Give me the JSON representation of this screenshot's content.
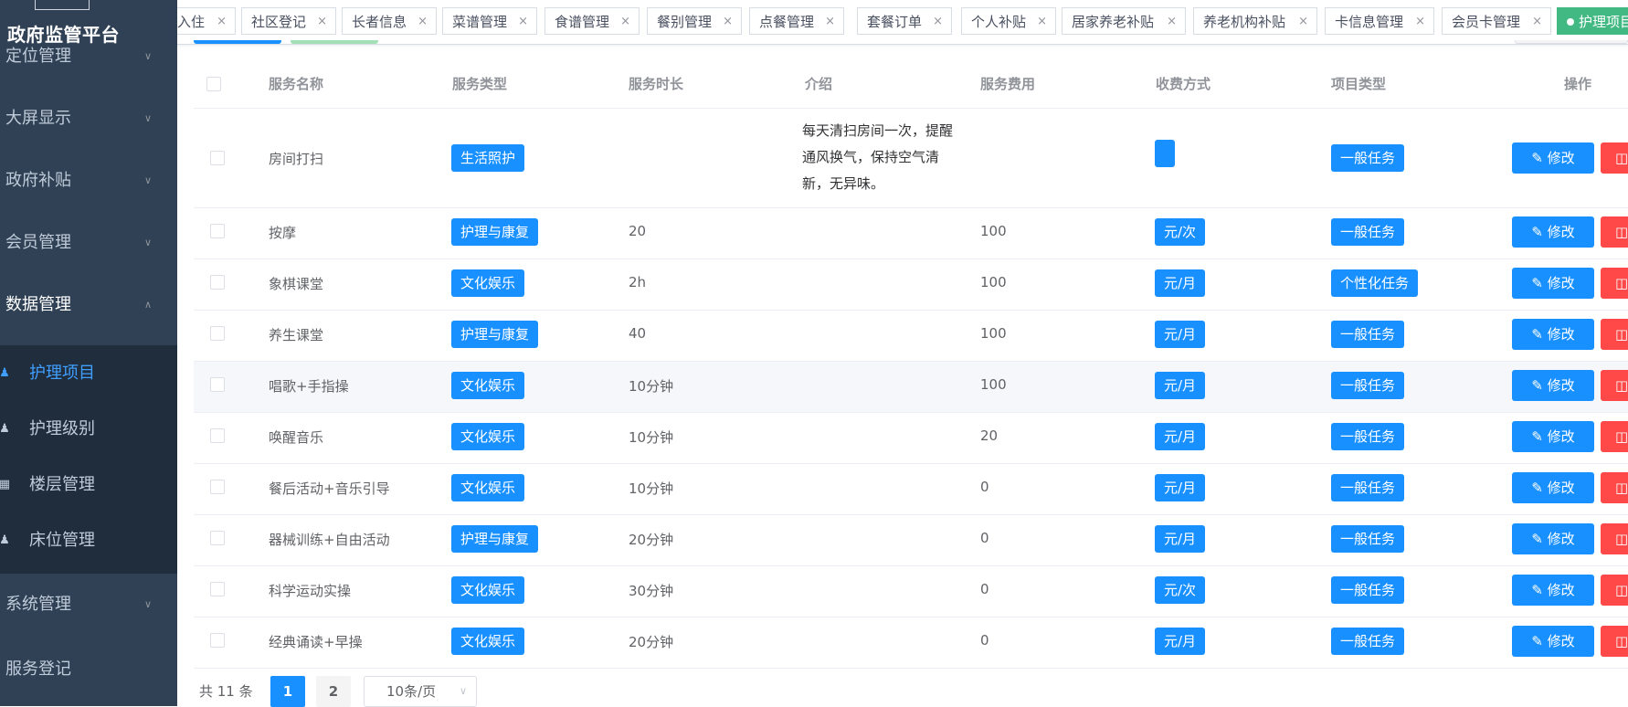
{
  "sidebar": {
    "brand": "政府监管平台",
    "menus": [
      {
        "label": "定位管理"
      },
      {
        "label": "大屏显示"
      },
      {
        "label": "政府补贴"
      },
      {
        "label": "会员管理"
      },
      {
        "label": "数据管理"
      },
      {
        "label": "系统管理"
      },
      {
        "label": "服务登记"
      }
    ],
    "sub_items": [
      {
        "label": "护理项目",
        "icon": "person-icon"
      },
      {
        "label": "护理级别",
        "icon": "person-icon"
      },
      {
        "label": "楼层管理",
        "icon": "grid-icon"
      },
      {
        "label": "床位管理",
        "icon": "person-icon"
      }
    ]
  },
  "tags": [
    {
      "label": "入住"
    },
    {
      "label": "社区登记"
    },
    {
      "label": "长者信息"
    },
    {
      "label": "菜谱管理"
    },
    {
      "label": "食谱管理"
    },
    {
      "label": "餐别管理"
    },
    {
      "label": "点餐管理"
    },
    {
      "label": "套餐订单"
    },
    {
      "label": "个人补贴"
    },
    {
      "label": "居家养老补贴"
    },
    {
      "label": "养老机构补贴"
    },
    {
      "label": "卡信息管理"
    },
    {
      "label": "会员卡管理"
    },
    {
      "label": "护理项目"
    }
  ],
  "table": {
    "headers": {
      "name": "服务名称",
      "type": "服务类型",
      "duration": "服务时长",
      "intro": "介绍",
      "fee": "服务费用",
      "charge": "收费方式",
      "project": "项目类型",
      "ops": "操作"
    },
    "edit_label": "修改",
    "rows": [
      {
        "name": "房间打扫",
        "type": "生活照护",
        "duration": "",
        "intro": "每天清扫房间一次，提醒通风换气，保持空气清新，无异味。",
        "fee": "",
        "charge": "",
        "project": "一般任务"
      },
      {
        "name": "按摩",
        "type": "护理与康复",
        "duration": "20",
        "intro": "",
        "fee": "100",
        "charge": "元/次",
        "project": "一般任务"
      },
      {
        "name": "象棋课堂",
        "type": "文化娱乐",
        "duration": "2h",
        "intro": "",
        "fee": "100",
        "charge": "元/月",
        "project": "个性化任务"
      },
      {
        "name": "养生课堂",
        "type": "护理与康复",
        "duration": "40",
        "intro": "",
        "fee": "100",
        "charge": "元/月",
        "project": "一般任务"
      },
      {
        "name": "唱歌+手指操",
        "type": "文化娱乐",
        "duration": "10分钟",
        "intro": "",
        "fee": "100",
        "charge": "元/月",
        "project": "一般任务"
      },
      {
        "name": "唤醒音乐",
        "type": "文化娱乐",
        "duration": "10分钟",
        "intro": "",
        "fee": "20",
        "charge": "元/月",
        "project": "一般任务"
      },
      {
        "name": "餐后活动+音乐引导",
        "type": "文化娱乐",
        "duration": "10分钟",
        "intro": "",
        "fee": "0",
        "charge": "元/月",
        "project": "一般任务"
      },
      {
        "name": "器械训练+自由活动",
        "type": "护理与康复",
        "duration": "20分钟",
        "intro": "",
        "fee": "0",
        "charge": "元/月",
        "project": "一般任务"
      },
      {
        "name": "科学运动实操",
        "type": "文化娱乐",
        "duration": "30分钟",
        "intro": "",
        "fee": "0",
        "charge": "元/次",
        "project": "一般任务"
      },
      {
        "name": "经典诵读+早操",
        "type": "文化娱乐",
        "duration": "20分钟",
        "intro": "",
        "fee": "0",
        "charge": "元/月",
        "project": "一般任务"
      }
    ]
  },
  "pagination": {
    "total": "共 11 条",
    "pages": [
      "1",
      "2"
    ],
    "page_size": "10条/页"
  },
  "colors": {
    "sidebar_bg": "#304156",
    "submenu_bg": "#1f2d3d",
    "primary": "#1890ff",
    "danger": "#ff4949",
    "active_tag": "#42b983"
  }
}
